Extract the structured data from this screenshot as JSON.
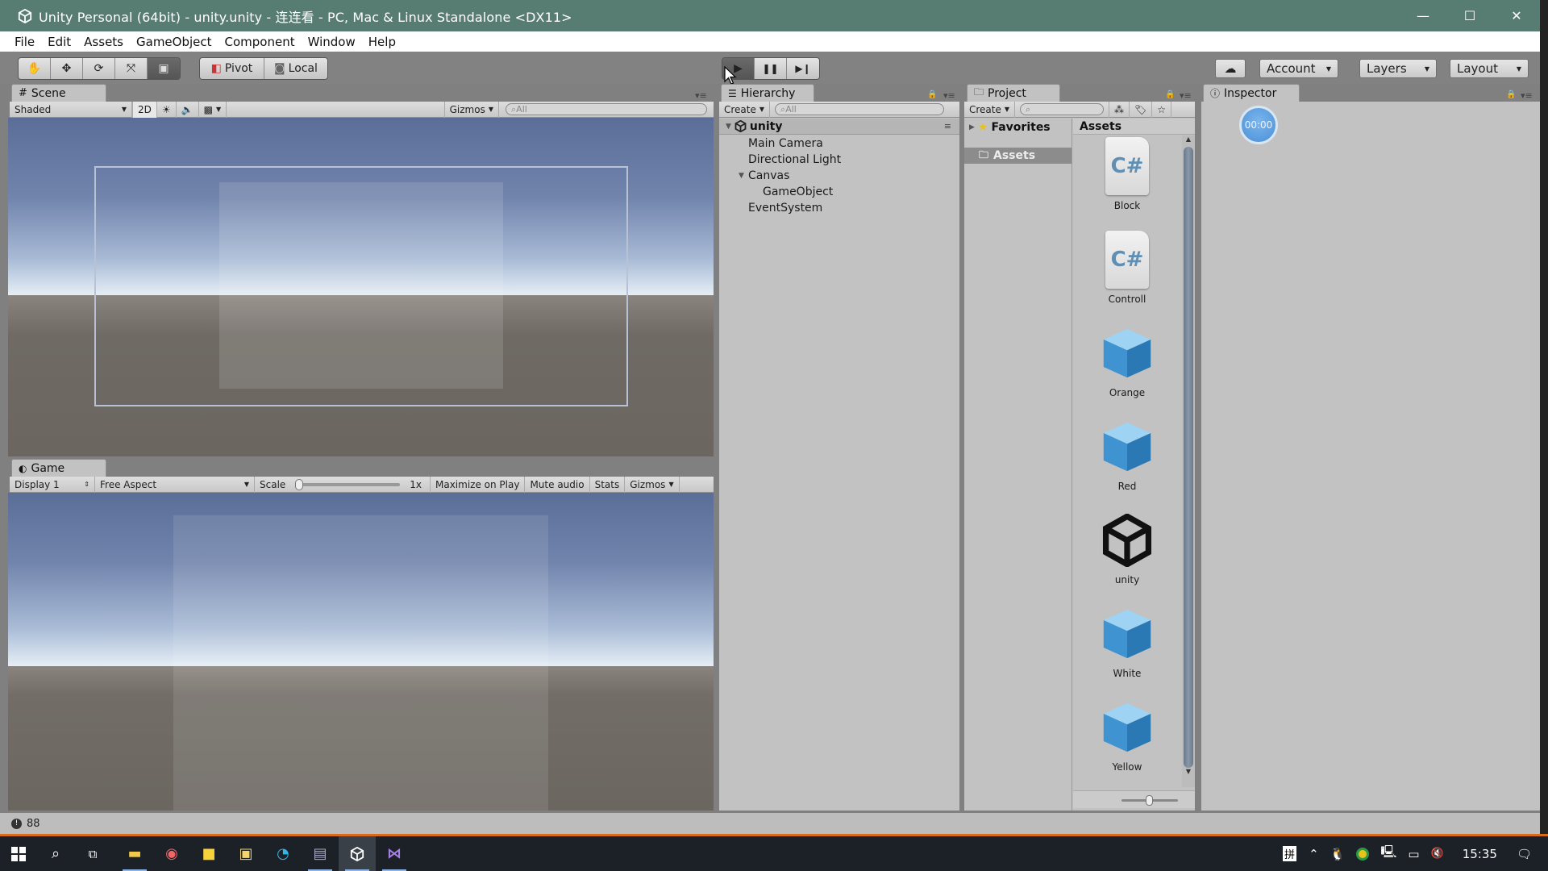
{
  "window": {
    "title": "Unity Personal (64bit) - unity.unity - 连连看 - PC, Mac & Linux Standalone <DX11>",
    "controls": {
      "minimize": "—",
      "maximize": "☐",
      "close": "✕"
    }
  },
  "menu": [
    "File",
    "Edit",
    "Assets",
    "GameObject",
    "Component",
    "Window",
    "Help"
  ],
  "toolbar": {
    "tools": [
      {
        "name": "hand-tool",
        "glyph": "✋"
      },
      {
        "name": "move-tool",
        "glyph": "✥"
      },
      {
        "name": "rotate-tool",
        "glyph": "⟳"
      },
      {
        "name": "scale-tool",
        "glyph": "⤧"
      },
      {
        "name": "rect-tool",
        "glyph": "▣"
      }
    ],
    "active_tool": "rect-tool",
    "pivot_label": "Pivot",
    "local_label": "Local",
    "play": {
      "play": "▶",
      "pause": "❚❚",
      "step": "▶❙"
    },
    "cloud_glyph": "☁",
    "account_label": "Account",
    "layers_label": "Layers",
    "layout_label": "Layout"
  },
  "scene": {
    "tab_label": "Scene",
    "shading": "Shaded",
    "mode_2d": "2D",
    "gizmos_label": "Gizmos",
    "search_placeholder": "All"
  },
  "game": {
    "tab_label": "Game",
    "display": "Display 1",
    "aspect": "Free Aspect",
    "scale_label": "Scale",
    "scale_value": "1x",
    "scale_fraction": 0.0,
    "maximize_on_play": "Maximize on Play",
    "mute_audio": "Mute audio",
    "stats": "Stats",
    "gizmos_label": "Gizmos"
  },
  "hierarchy": {
    "tab_label": "Hierarchy",
    "create_label": "Create",
    "search_placeholder": "All",
    "scene_name": "unity",
    "items": [
      {
        "label": "Main Camera",
        "depth": 1,
        "expandable": false
      },
      {
        "label": "Directional Light",
        "depth": 1,
        "expandable": false
      },
      {
        "label": "Canvas",
        "depth": 1,
        "expandable": true
      },
      {
        "label": "GameObject",
        "depth": 2,
        "expandable": false
      },
      {
        "label": "EventSystem",
        "depth": 1,
        "expandable": false
      }
    ]
  },
  "project": {
    "tab_label": "Project",
    "create_label": "Create",
    "favorites_label": "Favorites",
    "assets_folder_label": "Assets",
    "assets_header": "Assets",
    "assets": [
      {
        "name": "Block",
        "type": "script"
      },
      {
        "name": "Controll",
        "type": "script"
      },
      {
        "name": "Orange",
        "type": "prefab"
      },
      {
        "name": "Red",
        "type": "prefab"
      },
      {
        "name": "unity",
        "type": "scene"
      },
      {
        "name": "White",
        "type": "prefab"
      },
      {
        "name": "Yellow",
        "type": "prefab"
      }
    ]
  },
  "inspector": {
    "tab_label": "Inspector",
    "timer_text": "00:00"
  },
  "status": {
    "count": "88"
  },
  "taskbar": {
    "ime": "拼",
    "clock": "15:35",
    "volume": "🔇"
  },
  "colors": {
    "titlebar": "#577d72",
    "accent_orange": "#d86a1f",
    "cube_blue": "#4fa3dc",
    "timer_blue": "#5aa0e6"
  }
}
